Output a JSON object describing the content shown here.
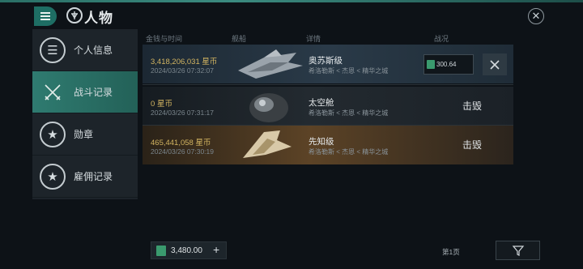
{
  "header": {
    "title": "人物"
  },
  "sidebar": {
    "items": [
      {
        "label": "个人信息",
        "icon": "menu-icon"
      },
      {
        "label": "战斗记录",
        "icon": "crossed-swords-icon",
        "active": true
      },
      {
        "label": "勋章",
        "icon": "star-badge-icon"
      },
      {
        "label": "雇佣记录",
        "icon": "star-badge-icon"
      }
    ]
  },
  "table": {
    "columns": [
      "金钱与时间",
      "舰船",
      "详情",
      "战况"
    ],
    "rows": [
      {
        "money": "3,418,206,031",
        "currency": "星币",
        "time": "2024/03/26  07:32:07",
        "ship_name": "奥苏斯级",
        "location": "希洛勒斯 < 杰恩 < 精华之城",
        "status": "",
        "value": "300.64"
      },
      {
        "money": "0",
        "currency": "星币",
        "time": "2024/03/26  07:31:17",
        "ship_name": "太空舱",
        "location": "希洛勒斯 < 杰恩 < 精华之城",
        "status": "击毁"
      },
      {
        "money": "465,441,058",
        "currency": "星币",
        "time": "2024/03/26  07:30:19",
        "ship_name": "先知级",
        "location": "希洛勒斯 < 杰恩 < 精华之城",
        "status": "击毁"
      }
    ]
  },
  "footer": {
    "balance": "3,480.00",
    "add_label": "+",
    "page": "第1页"
  },
  "colors": {
    "accent": "#2f7b70",
    "money": "#d2b461"
  }
}
